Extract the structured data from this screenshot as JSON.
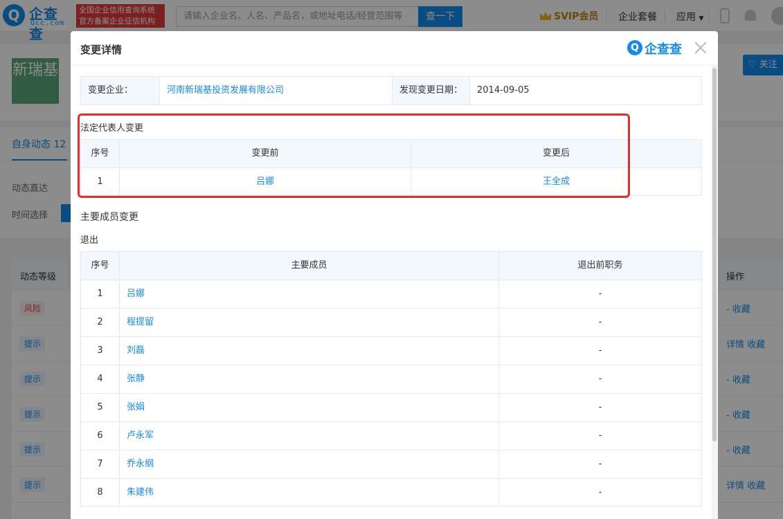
{
  "topbar": {
    "logo_cn": "企查查",
    "logo_en": "Qcc.com",
    "slogan_line1": "全国企业信用查询系统",
    "slogan_line2": "官方备案企业征信机构",
    "search_placeholder": "请输入企业名、人名、产品名，或地址电话/经营范围等",
    "search_button": "查一下",
    "svip": "SVIP会员",
    "nav_enterprise": "企业套餐",
    "nav_apps": "应用"
  },
  "background": {
    "company_logo_text": "新瑞基",
    "follow_label": "关注",
    "tab_active": "自身动态 12",
    "filter_direct": "动态直达",
    "filter_time": "时间选择",
    "table_head_left": "动态等级",
    "table_head_right": "操作",
    "rows": [
      {
        "level": "风险",
        "ops": "- 收藏"
      },
      {
        "level": "提示",
        "ops": "详情 收藏"
      },
      {
        "level": "提示",
        "ops": "- 收藏"
      },
      {
        "level": "提示",
        "ops": "- 收藏"
      },
      {
        "level": "提示",
        "ops": "- 收藏"
      },
      {
        "level": "提示",
        "ops": "详情 收藏"
      }
    ]
  },
  "modal": {
    "title": "变更详情",
    "brand": "企查查",
    "info": {
      "company_label": "变更企业：",
      "company_value": "河南新瑞基投资发展有限公司",
      "date_label": "发现变更日期：",
      "date_value": "2014-09-05"
    },
    "legal_rep": {
      "title": "法定代表人变更",
      "headers": [
        "序号",
        "变更前",
        "变更后"
      ],
      "rows": [
        {
          "no": "1",
          "before": "吕娜",
          "after": "王全成"
        }
      ]
    },
    "members": {
      "title": "主要成员变更",
      "subtitle": "退出",
      "headers": [
        "序号",
        "主要成员",
        "退出前职务"
      ],
      "rows": [
        {
          "no": "1",
          "name": "吕娜",
          "role": "-"
        },
        {
          "no": "2",
          "name": "程提留",
          "role": "-"
        },
        {
          "no": "3",
          "name": "刘磊",
          "role": "-"
        },
        {
          "no": "4",
          "name": "张静",
          "role": "-"
        },
        {
          "no": "5",
          "name": "张娟",
          "role": "-"
        },
        {
          "no": "6",
          "name": "卢永军",
          "role": "-"
        },
        {
          "no": "7",
          "name": "乔永纲",
          "role": "-"
        },
        {
          "no": "8",
          "name": "朱建伟",
          "role": "-"
        }
      ]
    }
  },
  "colors": {
    "accent": "#128bed",
    "highlight": "#e82c2c",
    "header_bg": "#f2f8fe"
  }
}
